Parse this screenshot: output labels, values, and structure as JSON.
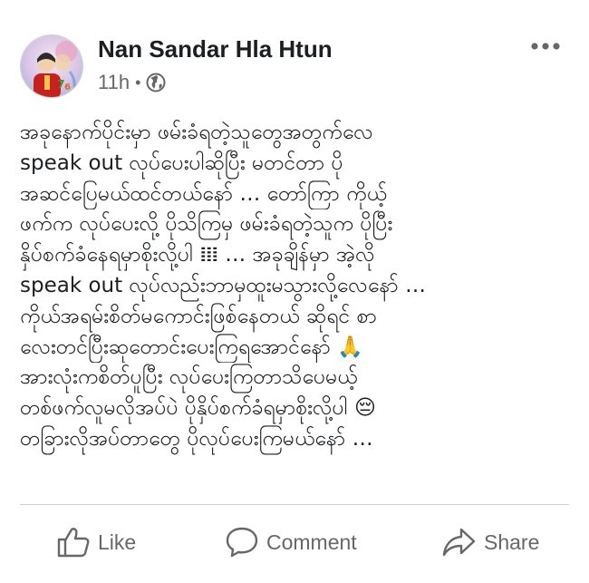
{
  "post": {
    "author": "Nan Sandar Hla Htun",
    "timestamp": "11h",
    "separator": "•",
    "privacy_icon": "globe-icon",
    "more_icon": "more-horizontal-icon",
    "avatar_icon": "profile-avatar-icon",
    "lines": [
      "အခုနောက်ပိုင်းမှာ ဖမ်းခံရတဲ့သူတွေအတွက်လေ",
      "speak out လုပ်ပေးပါဆိုပြီး မတင်တာ ပို",
      "အဆင်ပြေမယ်ထင်တယ်နော် … တော်ကြာ ကိုယ့်",
      "ဖက်က လုပ်ပေးလို့ ပိုသိကြမှ ဖမ်းခံရတဲ့သူက ပိုပြီး",
      "နှိပ်စက်ခံနေရမှာစိုးလို့ပါ 𝍖 … အခုချိန်မှာ အဲ့လို",
      "speak out လုပ်လည်းဘာမှထူးမသွားလို့လေနော် …",
      "ကိုယ်အရမ်းစိတ်မကောင်းဖြစ်နေတယ် ဆိုရင် စာ",
      "လေးတင်ပြီးဆုတောင်းပေးကြရအောင်နော် 🙏",
      "အားလုံးကစိတ်ပူပြီး လုပ်ပေးကြတာသိပေမယ့်",
      "တစ်ဖက်လူမလိုအပ်ပဲ ပိုနှိပ်စက်ခံရမှာစိုးလို့ပါ 😔",
      "တခြားလိုအပ်တာတွေ ပိုလုပ်ပေးကြမယ်နော် …"
    ]
  },
  "actions": {
    "like": {
      "label": "Like",
      "icon": "thumbs-up-icon"
    },
    "comment": {
      "label": "Comment",
      "icon": "comment-icon"
    },
    "share": {
      "label": "Share",
      "icon": "share-arrow-icon"
    }
  },
  "colors": {
    "text": "#1c1e21",
    "secondary": "#65676b",
    "divider": "#ced0d4",
    "background": "#ffffff"
  }
}
